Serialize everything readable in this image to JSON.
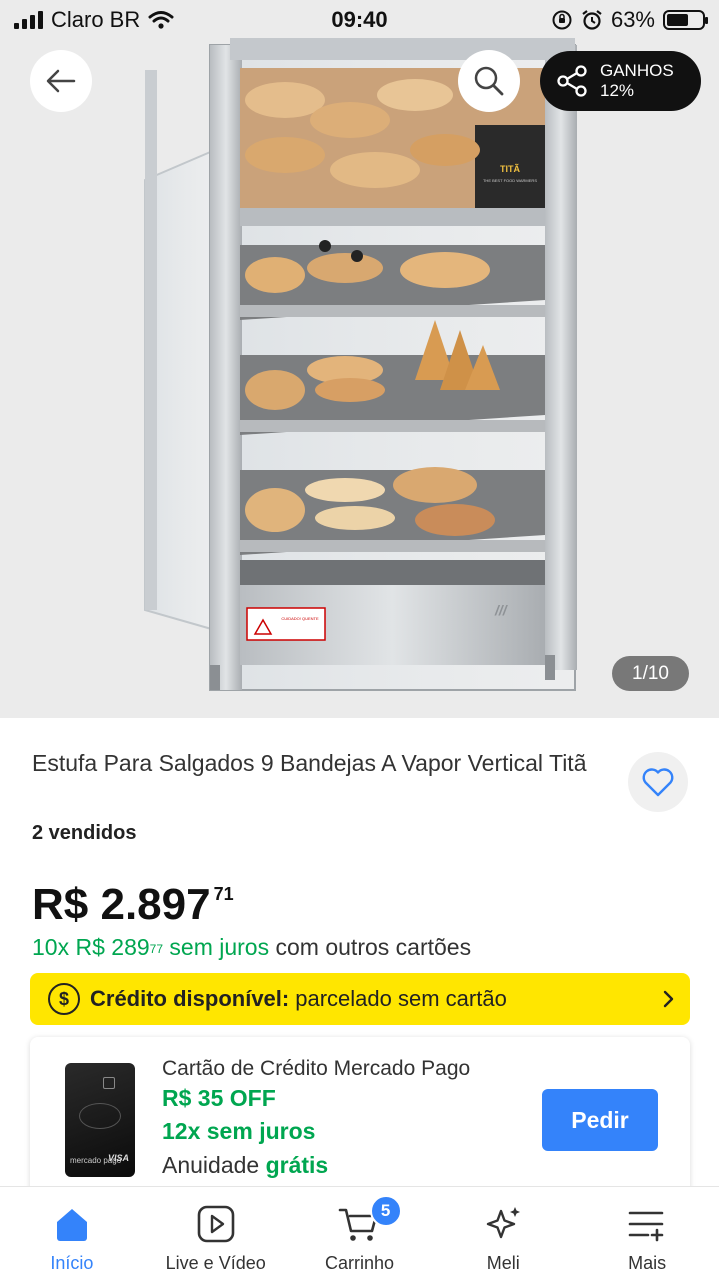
{
  "status_bar": {
    "carrier": "Claro BR",
    "time": "09:40",
    "battery": "63%",
    "battery_level": 0.63
  },
  "gallery": {
    "share_title": "GANHOS",
    "share_percent": "12%",
    "page_indicator": "1/10",
    "image_brand": "TITÃ",
    "image_slogan": "THE BEST FOOD WARMERS",
    "image_warning": "CUIDADO! QUENTE"
  },
  "product": {
    "title": "Estufa Para Salgados 9 Bandejas A Vapor Vertical Titã",
    "sold": "2 vendidos",
    "price_main": "R$ 2.897",
    "price_cents": "71",
    "installment_count": "10x",
    "installment_value": "R$ 289",
    "installment_cents": "77",
    "installment_green_suffix": "sem juros",
    "installment_rest": "com outros cartões"
  },
  "credit": {
    "icon_label": "$",
    "bold": "Crédito disponível:",
    "text": "parcelado sem cartão"
  },
  "card_offer": {
    "title": "Cartão de Crédito Mercado Pago",
    "discount": "R$ 35 OFF",
    "installments": "12x sem juros",
    "annual_prefix": "Anuidade",
    "annual_value": "grátis",
    "button": "Pedir",
    "card_brand": "mercado pago",
    "card_network": "VISA"
  },
  "tab_bar": {
    "items": [
      {
        "label": "Início",
        "icon": "home-icon",
        "active": true
      },
      {
        "label": "Live e Vídeo",
        "icon": "play-icon",
        "active": false
      },
      {
        "label": "Carrinho",
        "icon": "cart-icon",
        "active": false,
        "badge": "5"
      },
      {
        "label": "Meli",
        "icon": "sparkle-icon",
        "active": false
      },
      {
        "label": "Mais",
        "icon": "menu-plus-icon",
        "active": false
      }
    ]
  },
  "colors": {
    "accent_blue": "#3483fa",
    "green": "#00a650",
    "yellow": "#ffe600"
  }
}
